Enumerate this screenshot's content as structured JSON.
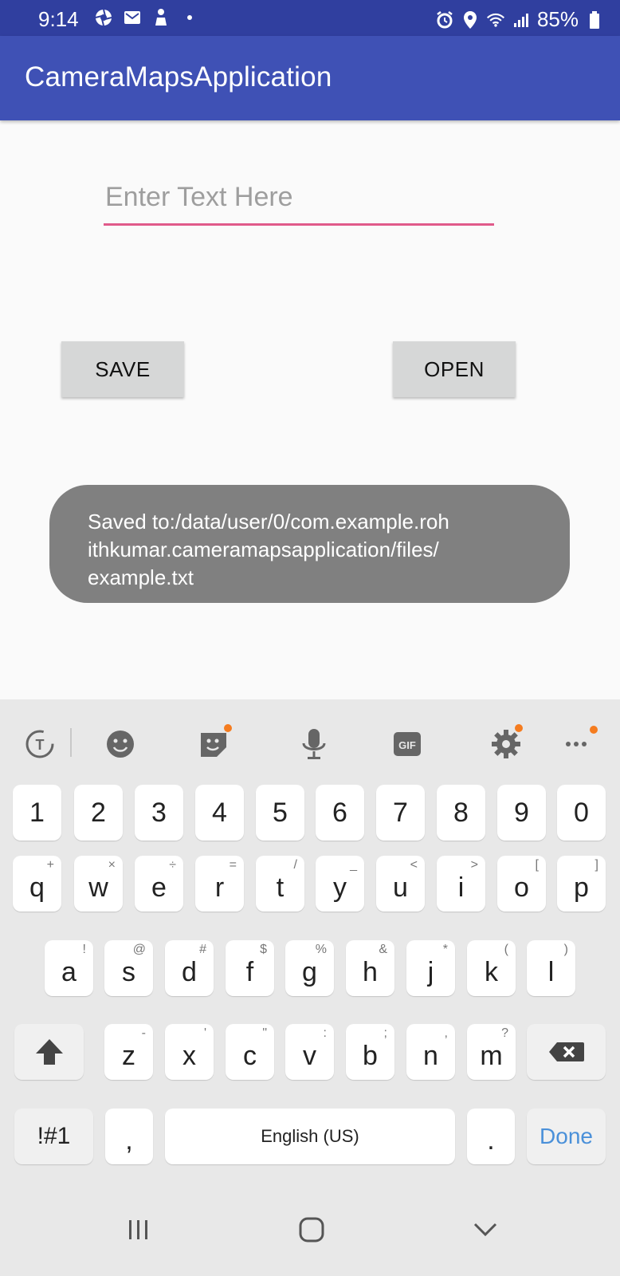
{
  "status_bar": {
    "time": "9:14",
    "battery": "85%"
  },
  "app_bar": {
    "title": "CameraMapsApplication"
  },
  "form": {
    "placeholder": "Enter Text Here",
    "value": ""
  },
  "buttons": {
    "save": "SAVE",
    "open": "OPEN"
  },
  "toast": {
    "lines": [
      "Saved to:/data/user/0/com.example.roh",
      "ithkumar.cameramapsapplication/files/",
      "example.txt"
    ]
  },
  "keyboard": {
    "number_row": [
      "1",
      "2",
      "3",
      "4",
      "5",
      "6",
      "7",
      "8",
      "9",
      "0"
    ],
    "row1": [
      {
        "key": "q",
        "sup": "+"
      },
      {
        "key": "w",
        "sup": "×"
      },
      {
        "key": "e",
        "sup": "÷"
      },
      {
        "key": "r",
        "sup": "="
      },
      {
        "key": "t",
        "sup": "/"
      },
      {
        "key": "y",
        "sup": "_"
      },
      {
        "key": "u",
        "sup": "<"
      },
      {
        "key": "i",
        "sup": ">"
      },
      {
        "key": "o",
        "sup": "["
      },
      {
        "key": "p",
        "sup": "]"
      }
    ],
    "row2": [
      {
        "key": "a",
        "sup": "!"
      },
      {
        "key": "s",
        "sup": "@"
      },
      {
        "key": "d",
        "sup": "#"
      },
      {
        "key": "f",
        "sup": "$"
      },
      {
        "key": "g",
        "sup": "%"
      },
      {
        "key": "h",
        "sup": "&"
      },
      {
        "key": "j",
        "sup": "*"
      },
      {
        "key": "k",
        "sup": "("
      },
      {
        "key": "l",
        "sup": ")"
      }
    ],
    "row3": [
      {
        "key": "z",
        "sup": "-"
      },
      {
        "key": "x",
        "sup": "'"
      },
      {
        "key": "c",
        "sup": "\""
      },
      {
        "key": "v",
        "sup": ":"
      },
      {
        "key": "b",
        "sup": ";"
      },
      {
        "key": "n",
        "sup": ","
      },
      {
        "key": "m",
        "sup": "?"
      }
    ],
    "symbols_label": "!#1",
    "comma_label": ",",
    "space_label": "English (US)",
    "period_label": ".",
    "done_label": "Done",
    "accent_color": "#4a90d9"
  }
}
